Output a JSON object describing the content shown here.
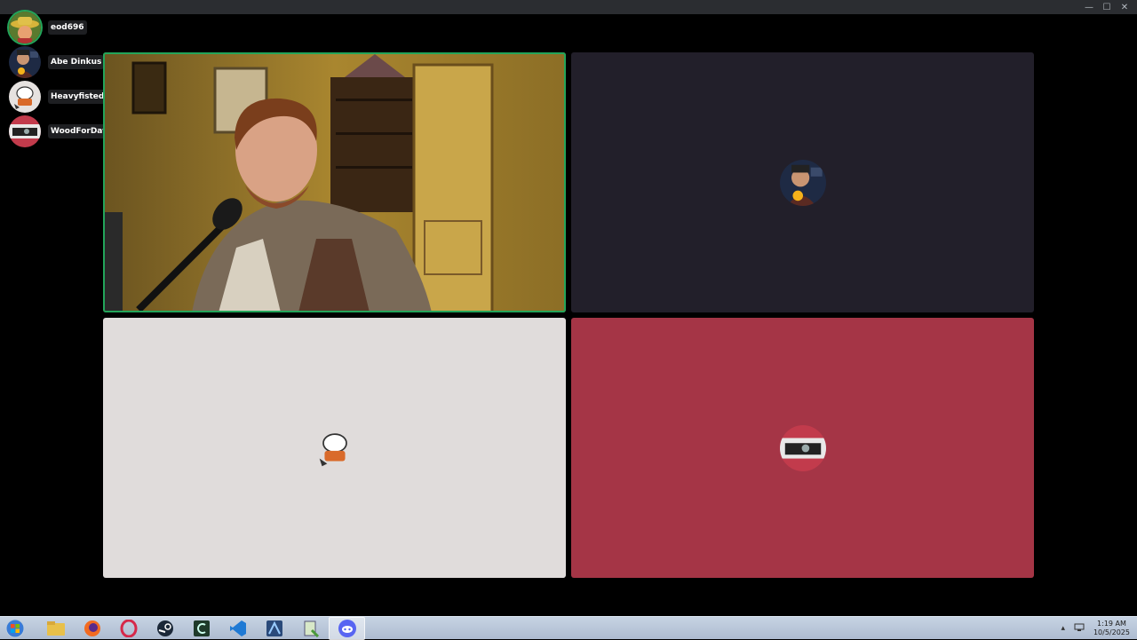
{
  "window": {
    "controls": {
      "minimize": "—",
      "maximize": "☐",
      "close": "✕"
    }
  },
  "participants": [
    {
      "name": "eod696",
      "avatar": "hat-cowboy-avatar",
      "speaking": true
    },
    {
      "name": "Abe Dinkus",
      "avatar": "abe-talk-avatar",
      "speaking": false
    },
    {
      "name": "Heavyfisted",
      "avatar": "sketch-character-avatar",
      "speaking": false
    },
    {
      "name": "WoodForDays",
      "avatar": "car-driver-avatar",
      "speaking": false
    }
  ],
  "tiles": [
    {
      "id": "video",
      "participant": "eod696",
      "type": "camera"
    },
    {
      "id": "abe",
      "participant": "Abe Dinkus",
      "type": "avatar",
      "color": "#221f2a"
    },
    {
      "id": "heavy",
      "participant": "Heavyfisted",
      "type": "avatar",
      "color": "#e0dcdb"
    },
    {
      "id": "wood",
      "participant": "WoodForDays",
      "type": "avatar",
      "color": "#a53546"
    }
  ],
  "colors": {
    "speaking": "#23a55a",
    "name_bg": "#1e1f22"
  },
  "taskbar": {
    "apps": [
      "folder-icon",
      "firefox-icon",
      "opera-icon",
      "steam-icon",
      "app-c-icon",
      "vscode-icon",
      "app-blue-icon",
      "notepad-icon",
      "discord-icon"
    ],
    "active_app": "discord-icon",
    "tray": {
      "chevron": "▴"
    },
    "clock": {
      "time": "1:19 AM",
      "date": "10/5/2025"
    }
  }
}
